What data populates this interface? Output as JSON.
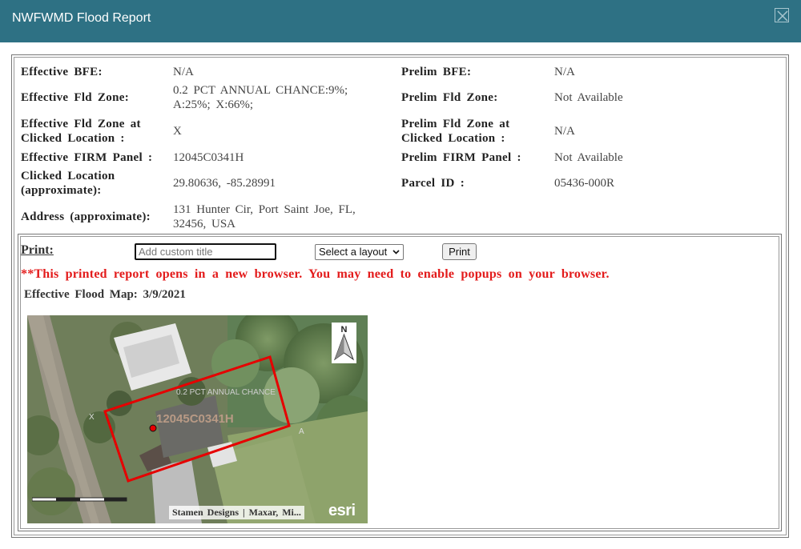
{
  "window": {
    "title": "NWFWMD Flood Report",
    "close_icon": "close-icon"
  },
  "report": {
    "left": [
      {
        "label": "Effective BFE:",
        "value": "N/A"
      },
      {
        "label": "Effective Fld Zone:",
        "value": "0.2 PCT ANNUAL CHANCE:9%; A:25%; X:66%;"
      },
      {
        "label": "Effective Fld Zone at Clicked Location :",
        "value": "X"
      },
      {
        "label": "Effective FIRM Panel :",
        "value": "12045C0341H"
      },
      {
        "label": "Clicked Location (approximate):",
        "value": "29.80636, -85.28991"
      },
      {
        "label": "Address (approximate):",
        "value": "131 Hunter Cir, Port Saint Joe, FL, 32456, USA"
      }
    ],
    "right": [
      {
        "label": "Prelim BFE:",
        "value": "N/A"
      },
      {
        "label": "Prelim Fld Zone:",
        "value": "Not Available"
      },
      {
        "label": "Prelim Fld Zone at Clicked Location :",
        "value": "N/A"
      },
      {
        "label": "Prelim FIRM Panel :",
        "value": "Not Available"
      },
      {
        "label": "Parcel ID :",
        "value": "05436-000R"
      }
    ]
  },
  "print": {
    "label": "Print:",
    "title_placeholder": "Add custom title",
    "layout_selected": "Select a layout",
    "print_button": "Print",
    "notice": "**This printed report opens in a new browser. You may need to enable popups on your browser."
  },
  "map": {
    "title": "Effective Flood Map: 3/9/2021",
    "zone_label": "0.2 PCT ANNUAL CHANCE",
    "panel_label": "12045C0341H",
    "zone_x": "X",
    "zone_a": "A",
    "north_label": "N",
    "attribution": "Stamen Designs | Maxar, Mi...",
    "logo_text": "esri",
    "parcel_color": "#e60000",
    "point_color": "#e60000"
  }
}
